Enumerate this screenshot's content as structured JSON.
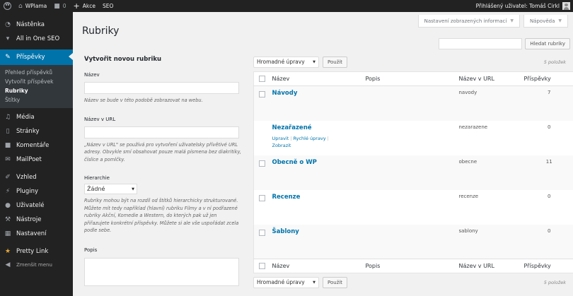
{
  "admin_bar": {
    "site_name": "WPlama",
    "comments_count": "0",
    "new_label": "Akce",
    "seo_label": "SEO",
    "greeting": "Přihlášený uživatel: Tomáš Cirkl"
  },
  "sidebar": {
    "items": [
      {
        "label": "Nástěnka",
        "icon": "dashboard-icon"
      },
      {
        "label": "All in One SEO",
        "icon": "seo-icon"
      },
      {
        "label": "Příspěvky",
        "icon": "pin-icon"
      },
      {
        "label": "Média",
        "icon": "media-icon"
      },
      {
        "label": "Stránky",
        "icon": "pages-icon"
      },
      {
        "label": "Komentáře",
        "icon": "comments-icon"
      },
      {
        "label": "MailPoet",
        "icon": "mail-icon"
      },
      {
        "label": "Vzhled",
        "icon": "appearance-icon"
      },
      {
        "label": "Pluginy",
        "icon": "plugins-icon"
      },
      {
        "label": "Uživatelé",
        "icon": "users-icon"
      },
      {
        "label": "Nástroje",
        "icon": "tools-icon"
      },
      {
        "label": "Nastavení",
        "icon": "settings-icon"
      },
      {
        "label": "Pretty Link",
        "icon": "star-icon"
      },
      {
        "label": "Zmenšit menu",
        "icon": "collapse-icon"
      }
    ],
    "submenu": [
      "Přehled příspěvků",
      "Vytvořit příspěvek",
      "Rubriky",
      "Štítky"
    ]
  },
  "header": {
    "title": "Rubriky",
    "screen_options": "Nastavení zobrazených informací",
    "help": "Nápověda"
  },
  "search": {
    "button": "Hledat rubriky",
    "value": ""
  },
  "form": {
    "heading": "Vytvořit novou rubriku",
    "name_label": "Název",
    "name_desc": "Název se bude v této podobě zobrazovat na webu.",
    "slug_label": "Název v URL",
    "slug_desc": "„Název v URL\" se používá pro vytvoření uživatelsky přívětivé URL adresy. Obvykle smí obsahovat pouze malá písmena bez diakritiky, číslice a pomlčky.",
    "parent_label": "Hierarchie",
    "parent_value": "Žádné",
    "parent_desc": "Rubriky mohou být na rozdíl od štítků hierarchicky strukturované. Můžete mít tedy například (hlavní) rubriku Filmy a v ní podřazené rubriky Akční, Komedie a Western, do kterých pak už jen přiřazujete konkrétní příspěvky. Můžete si ale vše uspořádat zcela podle sebe.",
    "description_label": "Popis"
  },
  "table": {
    "bulk_label": "Hromadné úpravy",
    "apply_label": "Použít",
    "count_text": "5 položek",
    "columns": {
      "name": "Název",
      "description": "Popis",
      "slug": "Název v URL",
      "posts": "Příspěvky"
    },
    "rows": [
      {
        "name": "Návody",
        "slug": "navody",
        "count": "7"
      },
      {
        "name": "Nezařazené",
        "slug": "nezarazene",
        "count": "0"
      },
      {
        "name": "Obecně o WP",
        "slug": "obecne",
        "count": "11"
      },
      {
        "name": "Recenze",
        "slug": "recenze",
        "count": "0"
      },
      {
        "name": "Šablony",
        "slug": "sablony",
        "count": "0"
      }
    ],
    "row_actions": {
      "edit": "Upravit",
      "quick_edit": "Rychlé úpravy",
      "delete": "Zobrazit"
    }
  }
}
